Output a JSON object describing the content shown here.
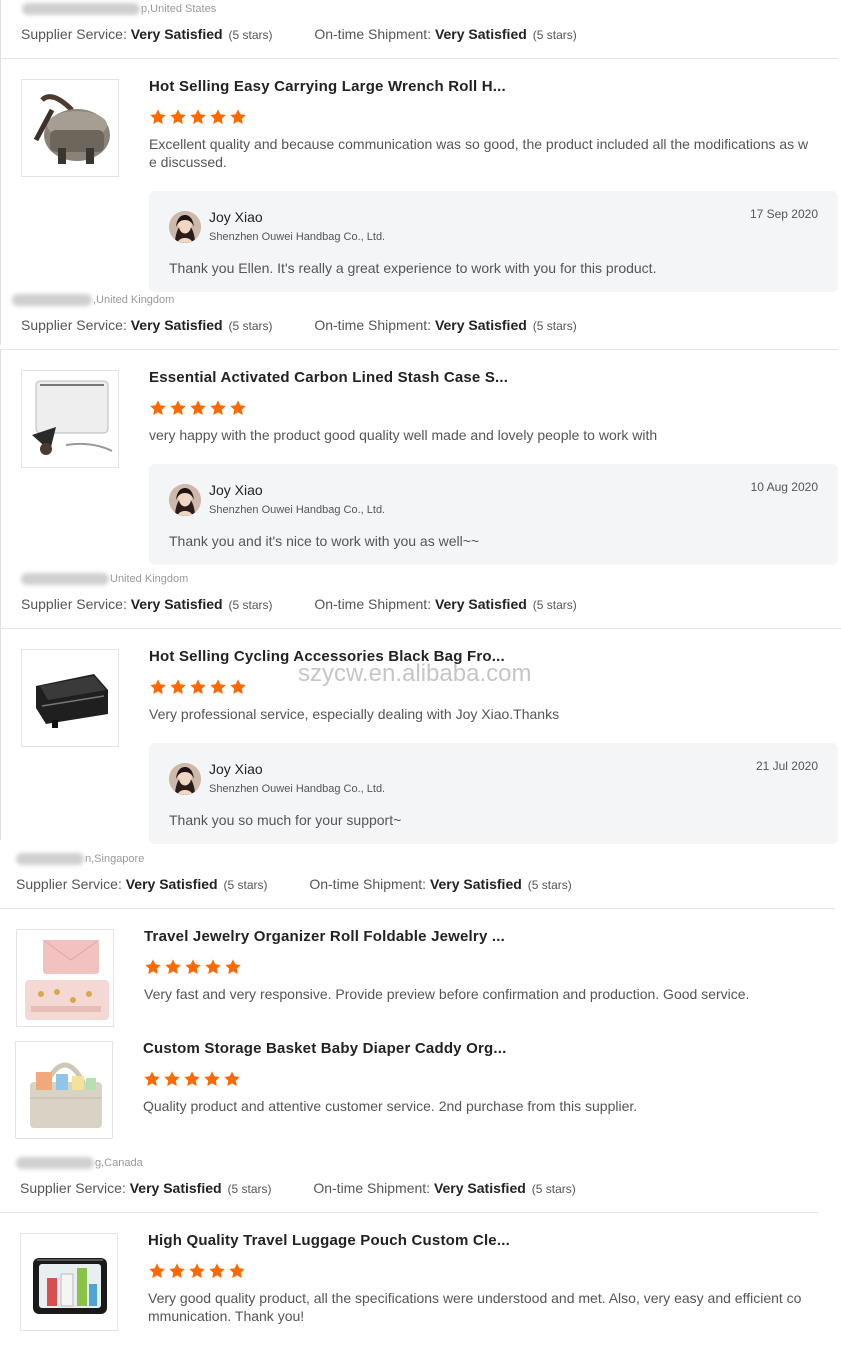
{
  "colors": {
    "star": "#ff6a00",
    "text": "#333333",
    "muted": "#999999",
    "reply_bg": "#f4f5f7"
  },
  "watermark": "szycw.en.alibaba.com",
  "labels": {
    "supplier_service": "Supplier Service:",
    "ontime": "On-time Shipment:",
    "very_satisfied": "Very Satisfied",
    "five_stars": "(5 stars)"
  },
  "locations": [
    "p,United States",
    ",United Kingdom",
    "United Kingdom",
    "n,Singapore",
    "g,Canada"
  ],
  "products": [
    {
      "title": "Hot Selling Easy Carrying Large Wrench Roll H...",
      "rating": 5,
      "review_line1": "Excellent quality and because communication was so good, the product included all the modifications as w",
      "review_line2": "e discussed.",
      "thumb_icon": "tool-bag-photo"
    },
    {
      "title": "Essential Activated Carbon Lined Stash Case S...",
      "rating": 5,
      "review_line1": "very happy with the product good quality well made and lovely people to work with",
      "thumb_icon": "stash-case-photo"
    },
    {
      "title": "Hot Selling Cycling Accessories Black Bag Fro...",
      "rating": 5,
      "review_line1": "Very professional service, especially dealing with Joy Xiao.Thanks",
      "thumb_icon": "bike-bag-photo"
    },
    {
      "title": "Travel Jewelry Organizer Roll Foldable Jewelry ...",
      "rating": 5,
      "review_line1": "Very fast and very responsive. Provide preview before confirmation and production. Good service.",
      "thumb_icon": "jewelry-roll-photo"
    },
    {
      "title": "Custom Storage Basket Baby Diaper Caddy Org...",
      "rating": 5,
      "review_line1": "Quality product and attentive customer service. 2nd purchase from this supplier.",
      "thumb_icon": "diaper-caddy-photo"
    },
    {
      "title": "High Quality Travel Luggage Pouch Custom Cle...",
      "rating": 5,
      "review_line1": "Very good quality product, all the specifications were understood and met. Also, very easy and efficient co",
      "review_line2": "mmunication. Thank you!",
      "thumb_icon": "clear-pouch-photo"
    }
  ],
  "replies": [
    {
      "name": "Joy Xiao",
      "company": "Shenzhen Ouwei Handbag Co., Ltd.",
      "date": "17 Sep 2020",
      "message": "Thank you Ellen. It's really a great experience to work with you for this product."
    },
    {
      "name": "Joy Xiao",
      "company": "Shenzhen Ouwei Handbag Co., Ltd.",
      "date": "10 Aug 2020",
      "message": "Thank you and it's nice to work with you as well~~"
    },
    {
      "name": "Joy Xiao",
      "company": "Shenzhen Ouwei Handbag Co., Ltd.",
      "date": "21 Jul 2020",
      "message": "Thank you so much for your support~"
    }
  ]
}
